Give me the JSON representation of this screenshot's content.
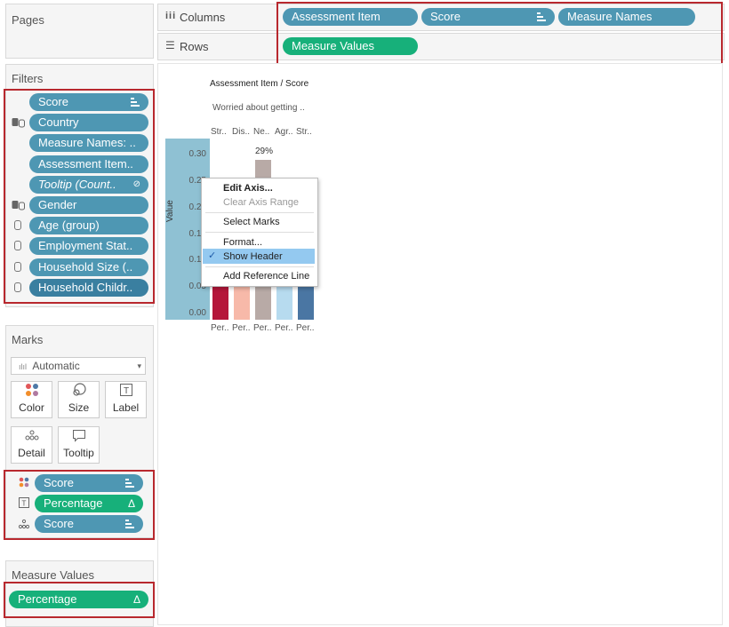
{
  "pages": {
    "title": "Pages"
  },
  "filters": {
    "title": "Filters",
    "items": [
      {
        "label": "Score",
        "trail": "sort"
      },
      {
        "label": "Country",
        "trail": ""
      },
      {
        "label": "Measure Names: ..",
        "trail": ""
      },
      {
        "label": "Assessment Item..",
        "trail": ""
      },
      {
        "label": "Tooltip (Count..",
        "trail": "link"
      },
      {
        "label": "Gender",
        "trail": ""
      },
      {
        "label": "Age (group)",
        "trail": ""
      },
      {
        "label": "Employment Stat..",
        "trail": ""
      },
      {
        "label": "Household Size (..",
        "trail": ""
      },
      {
        "label": "Household Childr..",
        "trail": ""
      }
    ]
  },
  "marks": {
    "title": "Marks",
    "type_select": "Automatic",
    "cards": [
      "Color",
      "Size",
      "Label",
      "Detail",
      "Tooltip"
    ],
    "pills": [
      {
        "label": "Score",
        "trail": "sort"
      },
      {
        "label": "Percentage",
        "trail": "Δ"
      },
      {
        "label": "Score",
        "trail": "sort"
      }
    ]
  },
  "measure_values": {
    "title": "Measure Values",
    "pill": {
      "label": "Percentage",
      "trail": "Δ"
    }
  },
  "shelves": {
    "columns_label": "Columns",
    "rows_label": "Rows",
    "columns_pills": [
      "Assessment Item",
      "Score",
      "Measure Names"
    ],
    "rows_pills": [
      "Measure Values"
    ]
  },
  "chart": {
    "header_title": "Assessment Item / Score",
    "subheader": "Worried about getting ..",
    "col_headers": [
      "Str..",
      "Dis..",
      "Ne..",
      "Agr..",
      "Str.."
    ],
    "bottom_labels": [
      "Per..",
      "Per..",
      "Per..",
      "Per..",
      "Per.."
    ],
    "y_axis_title": "Value",
    "y_ticks": [
      "0.30",
      "0.25",
      "0.20",
      "0.15",
      "0.10",
      "0.05",
      "0.00"
    ],
    "data_label": "29%",
    "colors": [
      "#b5163a",
      "#f7b9a9",
      "#b8aaa6",
      "#b7dbef",
      "#4a76a3"
    ]
  },
  "chart_data": {
    "type": "bar",
    "categories": [
      "Str..",
      "Dis..",
      "Ne..",
      "Agr..",
      "Str.."
    ],
    "values": [
      0.07,
      0.07,
      0.29,
      0.07,
      0.07
    ],
    "ylabel": "Value",
    "ylim": [
      0,
      0.3
    ]
  },
  "context_menu": {
    "items": [
      "Edit Axis...",
      "Clear Axis Range",
      "Select Marks",
      "Format...",
      "Show Header",
      "Add Reference Line"
    ],
    "checked": "Show Header"
  }
}
